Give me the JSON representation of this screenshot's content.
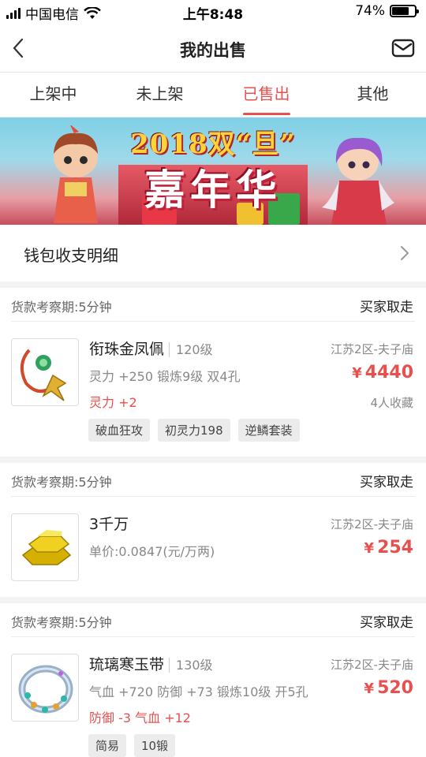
{
  "status_bar": {
    "carrier": "中国电信",
    "time": "上午8:48",
    "battery": "74%",
    "battery_level": 0.74
  },
  "nav": {
    "title": "我的出售"
  },
  "tabs": [
    {
      "label": "上架中"
    },
    {
      "label": "未上架"
    },
    {
      "label": "已售出",
      "active": true
    },
    {
      "label": "其他"
    }
  ],
  "banner": {
    "line1": "2018双“旦”",
    "line2": "嘉年华"
  },
  "wallet": {
    "label": "钱包收支明细"
  },
  "orders": [
    {
      "period": "货款考察期:5分钟",
      "action": "买家取走",
      "name": "衔珠金凤佩",
      "level": "120级",
      "server": "江苏2区-夫子庙",
      "attr1": "灵力 +250 锻炼9级 双4孔",
      "attr2": "灵力 +2",
      "price_symbol": "¥",
      "price": "4440",
      "favorites": "4人收藏",
      "tags": [
        "破血狂攻",
        "初灵力198",
        "逆鳞套装"
      ]
    },
    {
      "period": "货款考察期:5分钟",
      "action": "买家取走",
      "name": "3千万",
      "server": "江苏2区-夫子庙",
      "attr1": "单价:0.0847(元/万两)",
      "price_symbol": "¥",
      "price": "254"
    },
    {
      "period": "货款考察期:5分钟",
      "action": "买家取走",
      "name": "琉璃寒玉带",
      "level": "130级",
      "server": "江苏2区-夫子庙",
      "attr1": "气血 +720 防御 +73 锻炼10级 开5孔",
      "attr2": "防御 -3 气血 +12",
      "price_symbol": "¥",
      "price": "520",
      "tags": [
        "简易",
        "10锻"
      ]
    }
  ],
  "colors": {
    "accent": "#e8504f"
  }
}
